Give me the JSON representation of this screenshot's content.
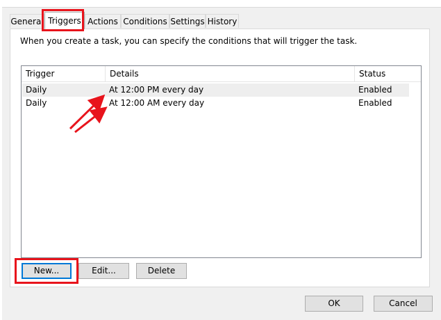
{
  "tabs": [
    "General",
    "Triggers",
    "Actions",
    "Conditions",
    "Settings",
    "History"
  ],
  "active_tab": "Triggers",
  "intro_text": "When you create a task, you can specify the conditions that will trigger the task.",
  "columns": [
    "Trigger",
    "Details",
    "Status"
  ],
  "rows": [
    {
      "trigger": "Daily",
      "details": "At 12:00 PM every day",
      "status": "Enabled"
    },
    {
      "trigger": "Daily",
      "details": "At 12:00 AM every day",
      "status": "Enabled"
    }
  ],
  "buttons": {
    "new": "New...",
    "edit": "Edit...",
    "delete": "Delete",
    "ok": "OK",
    "cancel": "Cancel"
  },
  "annotation_color": "#e8141c"
}
